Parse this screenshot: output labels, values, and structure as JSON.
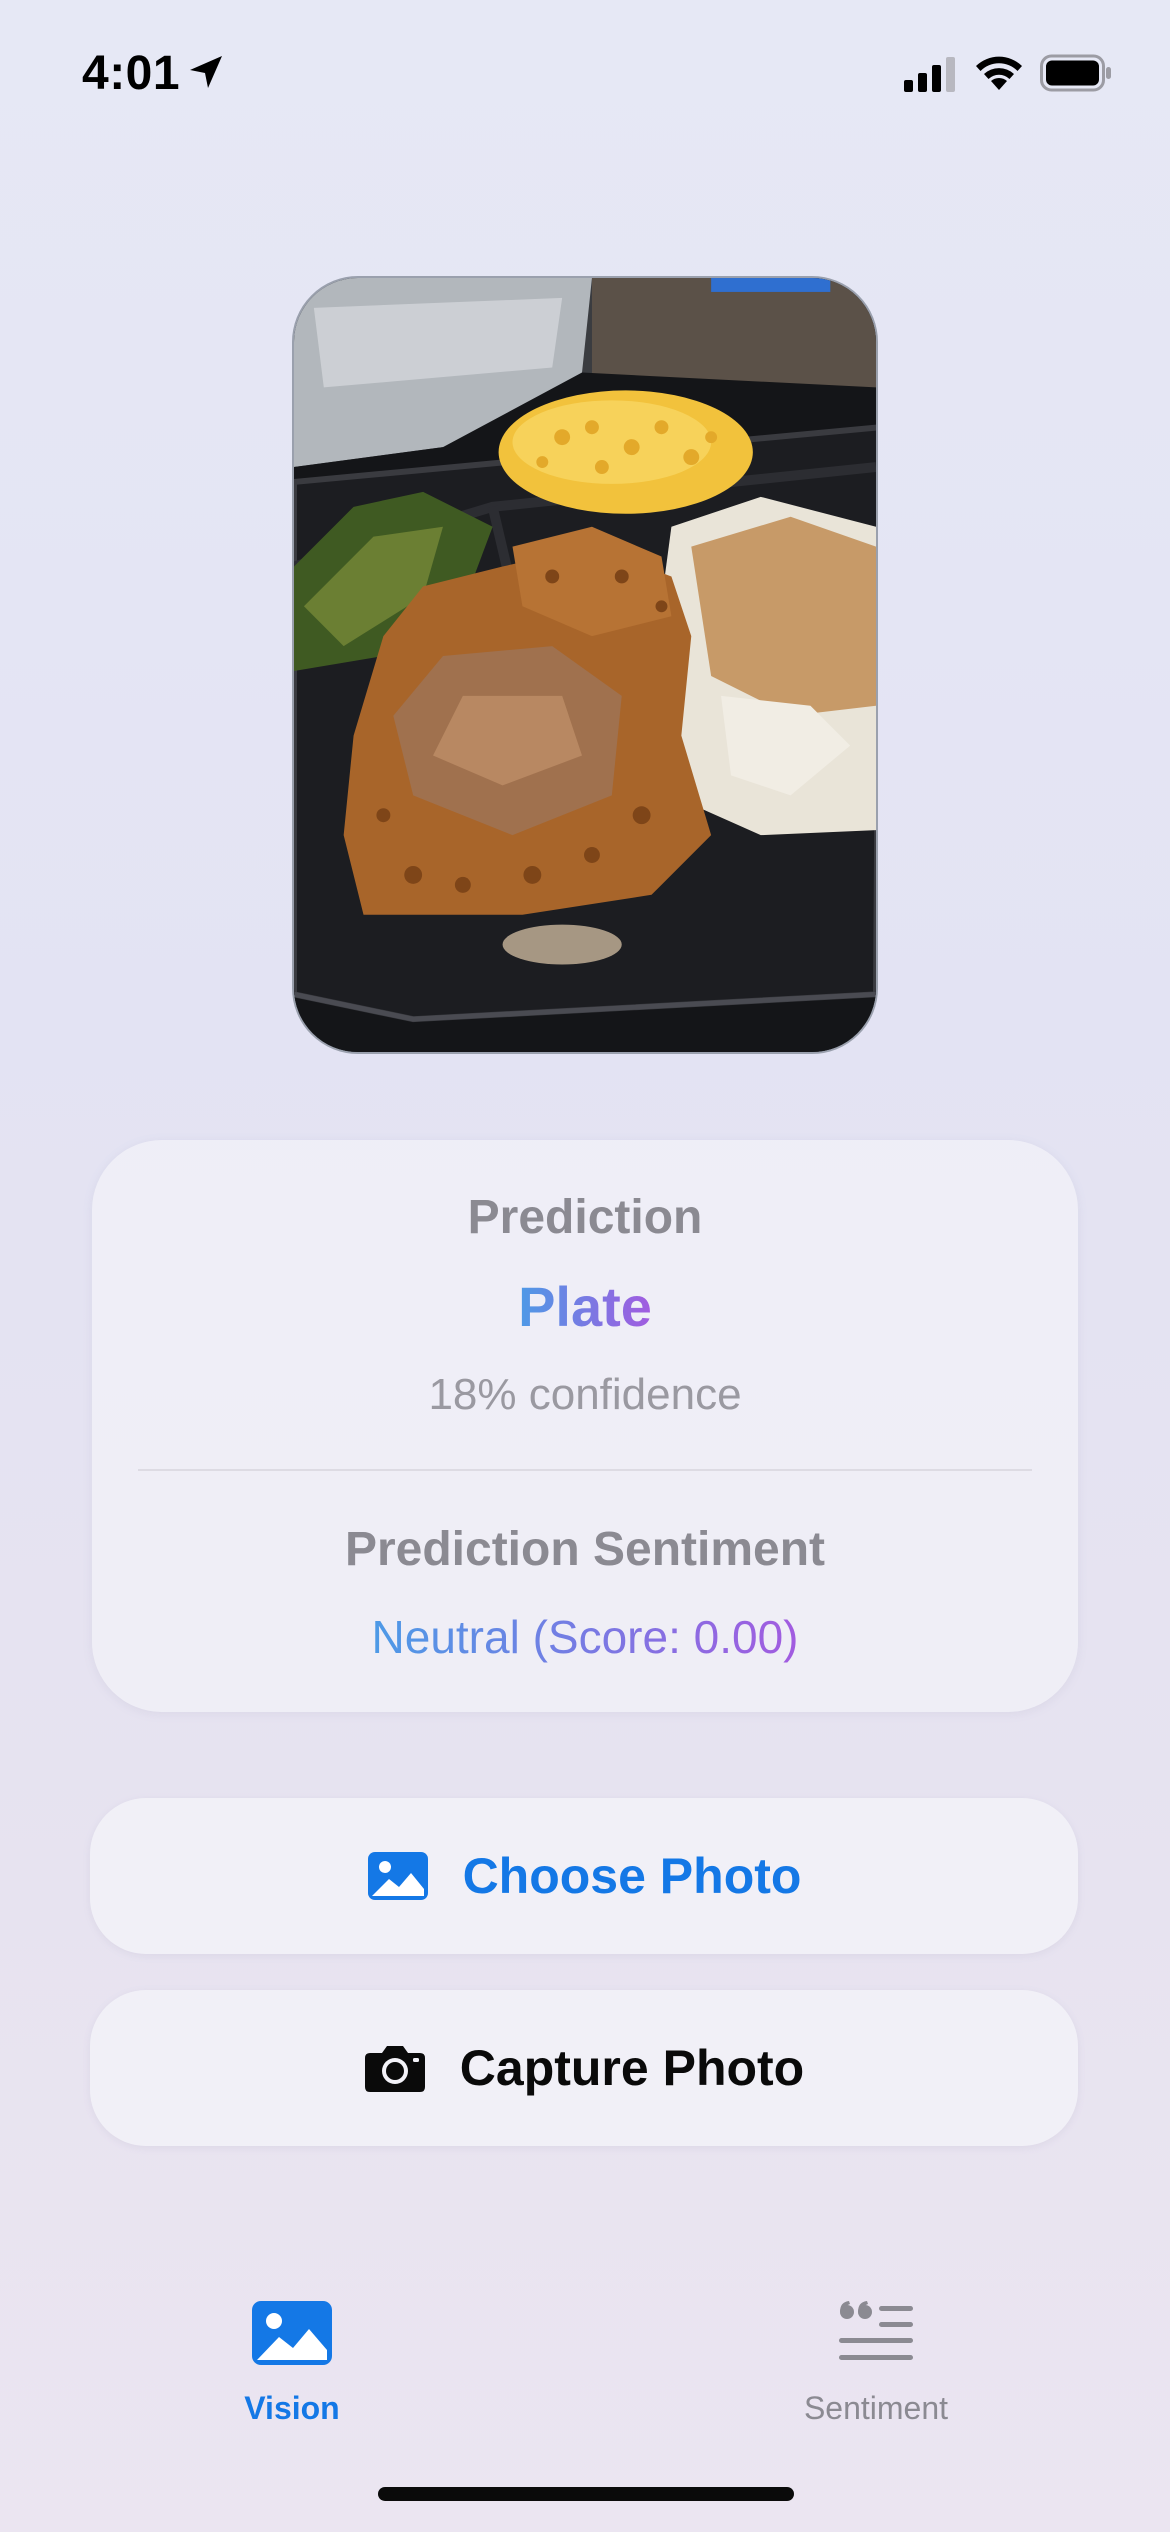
{
  "status_bar": {
    "time": "4:01",
    "icons": [
      "location-arrow-icon",
      "cellular-signal-icon",
      "wifi-icon",
      "battery-icon"
    ]
  },
  "photo": {
    "icon": "food-photo",
    "alt": "Fried chicken with gravy, mac and cheese, collard greens and mashed potatoes in a black takeout container"
  },
  "prediction": {
    "heading": "Prediction",
    "value": "Plate",
    "confidence": "18% confidence",
    "sentiment_heading": "Prediction Sentiment",
    "sentiment_value": "Neutral (Score: 0.00)"
  },
  "actions": {
    "choose_photo": {
      "label": "Choose Photo",
      "icon": "photo-icon"
    },
    "capture_photo": {
      "label": "Capture Photo",
      "icon": "camera-icon"
    }
  },
  "tab_bar": {
    "tabs": [
      {
        "label": "Vision",
        "icon": "photo-tab-icon",
        "active": true
      },
      {
        "label": "Sentiment",
        "icon": "quote-text-icon",
        "active": false
      }
    ]
  },
  "colors": {
    "accent": "#1478e6",
    "gradient_start": "#4d9ae6",
    "gradient_end": "#a25be0",
    "secondary_text": "#8b8a92"
  }
}
